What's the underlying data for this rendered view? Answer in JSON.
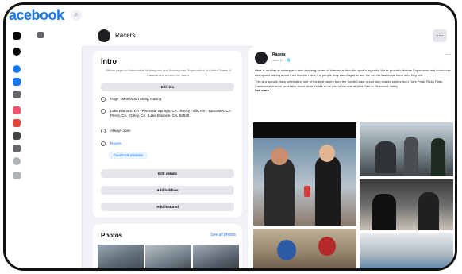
{
  "topbar": {
    "logo_text": "acebook"
  },
  "page": {
    "name": "Racers"
  },
  "intro": {
    "title": "Intro",
    "description": "Official page for Nationwide Motorsports and Motorsports Organization in United States & Canada and around the world.",
    "edit_bio_label": "Edit bio",
    "page_type": "Page · Motorsport entity, Racing",
    "address": "Lake Elsinore, CA · Riverside Springs, CA · Rocky Falls, NV · Lancaster, CA · Perris, CA · Gilroy, CA · Lake Elsinore, CA, 92530",
    "status": "Always open",
    "website_label": "Racers",
    "website_button": "Facebook Website",
    "edit_details_label": "Edit details",
    "add_hobbies_label": "Add hobbies",
    "add_featured_label": "Add featured"
  },
  "photos": {
    "title": "Photos",
    "see_all": "See all photos"
  },
  "post": {
    "author": "Racers",
    "meta": "June 17 · 🌐",
    "text1": "Here is another in a deep and awe-inspiring series of interviews from the sport's legends. We're proud to feature Supercross and motocross champions talking about their favorite rides, the people they raced against and the events that made them who they are.",
    "text2": "This is a special video celebrating one of the best racers from the South Coast circuit who shares stories from Torre Peak, Ricky Flats, Carlsbad and more, and talks about what it's like to be part of the ride at Wild Park in Pinewood Valley.",
    "see_more": "See more"
  },
  "colors": {
    "brand": "#1877f2",
    "background": "#f0f2f5",
    "card": "#ffffff"
  }
}
